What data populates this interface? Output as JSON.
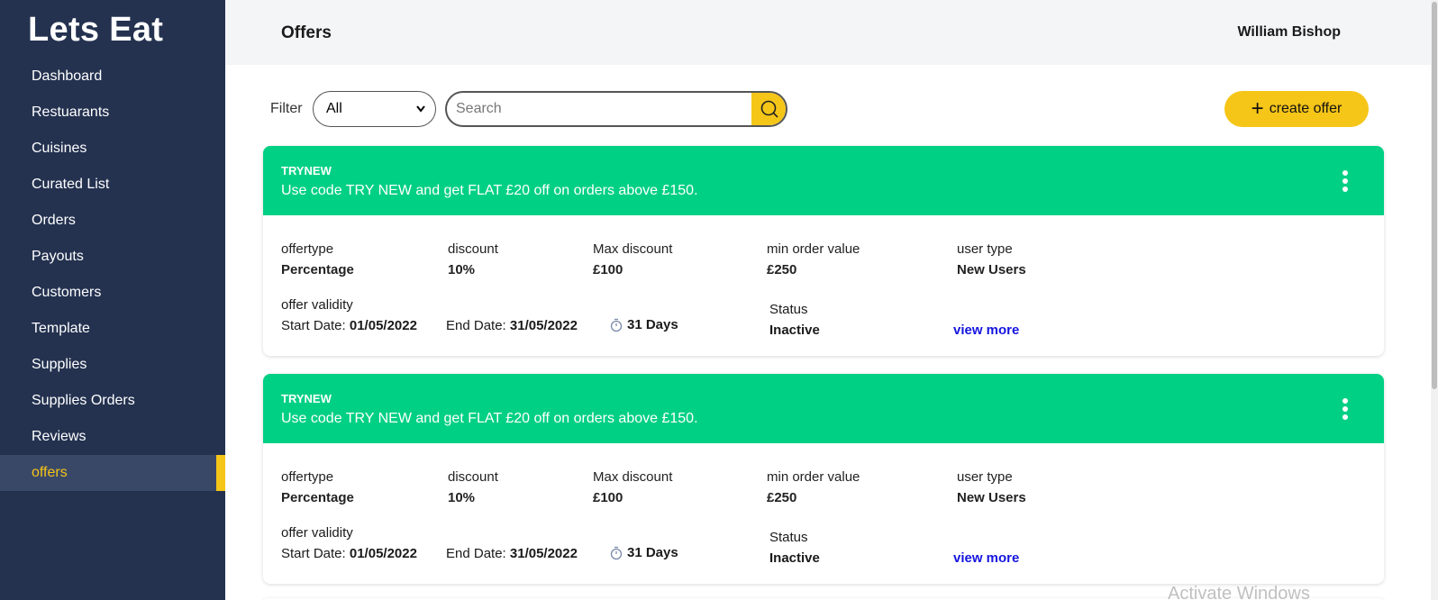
{
  "sidebar": {
    "brand": "Lets Eat",
    "items": [
      {
        "label": "Dashboard"
      },
      {
        "label": "Restuarants"
      },
      {
        "label": "Cuisines"
      },
      {
        "label": "Curated List"
      },
      {
        "label": "Orders"
      },
      {
        "label": "Payouts"
      },
      {
        "label": "Customers"
      },
      {
        "label": "Template"
      },
      {
        "label": "Supplies"
      },
      {
        "label": "Supplies Orders"
      },
      {
        "label": "Reviews"
      },
      {
        "label": "offers",
        "active": true
      }
    ]
  },
  "header": {
    "title": "Offers",
    "user": "William Bishop"
  },
  "toolbar": {
    "filter_label": "Filter",
    "filter_value": "All",
    "search_placeholder": "Search",
    "create_label": "create offer"
  },
  "colors": {
    "sidebar": "#243250",
    "accent": "#f5c518",
    "card_header": "#00d084",
    "link": "#1515e0"
  },
  "offers": [
    {
      "code": "TRYNEW",
      "description": "Use code TRY NEW and get FLAT £20 off on orders above £150.",
      "offertype_label": "offertype",
      "offertype": "Percentage",
      "discount_label": "discount",
      "discount": "10%",
      "max_discount_label": "Max discount",
      "max_discount": "£100",
      "min_order_label": "min order value",
      "min_order": "£250",
      "user_type_label": "user type",
      "user_type": "New Users",
      "validity_label": "offer validity",
      "start_label": "Start Date:",
      "start_date": "01/05/2022",
      "end_label": "End Date:",
      "end_date": "31/05/2022",
      "duration": "31 Days",
      "status_label": "Status",
      "status": "Inactive",
      "view_more": "view more"
    },
    {
      "code": "TRYNEW",
      "description": "Use code TRY NEW and get FLAT £20 off on orders above £150.",
      "offertype_label": "offertype",
      "offertype": "Percentage",
      "discount_label": "discount",
      "discount": "10%",
      "max_discount_label": "Max discount",
      "max_discount": "£100",
      "min_order_label": "min order value",
      "min_order": "£250",
      "user_type_label": "user type",
      "user_type": "New Users",
      "validity_label": "offer validity",
      "start_label": "Start Date:",
      "start_date": "01/05/2022",
      "end_label": "End Date:",
      "end_date": "31/05/2022",
      "duration": "31 Days",
      "status_label": "Status",
      "status": "Inactive",
      "view_more": "view more"
    }
  ],
  "watermark": "Activate Windows"
}
